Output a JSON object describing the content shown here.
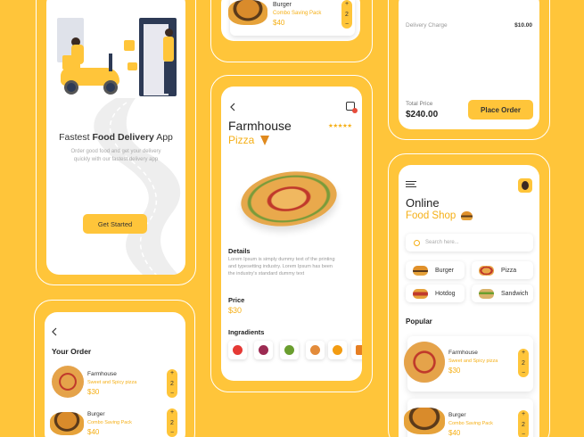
{
  "splash": {
    "headline_pre": "Fastest ",
    "headline_bold": "Food Delivery",
    "headline_post": " App",
    "sub1": "Order good food and get your delivery",
    "sub2": "quickly with our fastest delivery app",
    "cta": "Get Started"
  },
  "top_item": {
    "name": "Burger",
    "desc": "Combo Saving Pack",
    "price": "$40",
    "qty": "2"
  },
  "order": {
    "title": "Your Order",
    "items": [
      {
        "name": "Farmhouse",
        "desc": "Sweet and Spicy pizza",
        "price": "$30",
        "qty": "2"
      },
      {
        "name": "Burger",
        "desc": "Combo Saving Pack",
        "price": "$40",
        "qty": "2"
      }
    ]
  },
  "detail": {
    "title1": "Farmhouse",
    "title2": "Pizza",
    "stars": "★★★★★",
    "details_heading": "Details",
    "details_text1": "Lorem Ipsum is simply dummy text of the printing",
    "details_text2": "and typesetting industry. Lorem Ipsum has been",
    "details_text3": "the industry's standard dummy text",
    "price_heading": "Price",
    "price": "$30",
    "ingredients_heading": "Ingradients"
  },
  "checkout": {
    "delivery_label": "Delivery Charge",
    "delivery_value": "$10.00",
    "total_label": "Total Price",
    "total_value": "$240.00",
    "cta": "Place Order"
  },
  "shop": {
    "title1": "Online",
    "title2": "Food Shop",
    "search_placeholder": "Search here...",
    "categories": [
      "Burger",
      "Pizza",
      "Hotdog",
      "Sandwich"
    ],
    "popular_heading": "Popular",
    "popular": [
      {
        "name": "Farmhouse",
        "desc": "Sweet and Spicy pizza",
        "price": "$30",
        "qty": "2"
      },
      {
        "name": "Burger",
        "desc": "Combo Saving Pack",
        "price": "$40",
        "qty": "2"
      }
    ]
  },
  "stepper": {
    "plus": "+",
    "minus": "−"
  },
  "colors": {
    "accent": "#FFC53A",
    "price": "#F5AF16",
    "background": "#FFC53A"
  },
  "icons": [
    "back-icon",
    "bag-icon",
    "menu-icon",
    "avatar-icon",
    "search-icon",
    "pizza-slice-icon",
    "burger-icon"
  ]
}
